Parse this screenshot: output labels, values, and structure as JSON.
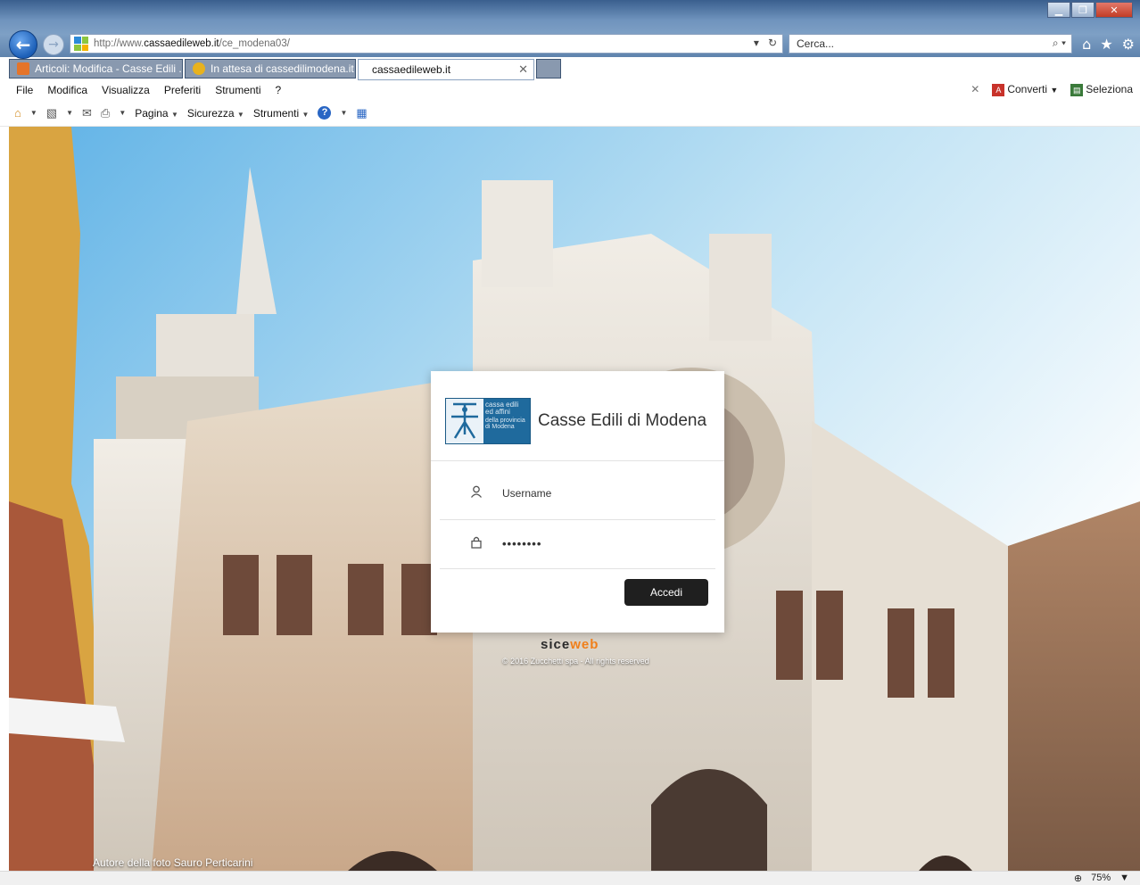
{
  "browser": {
    "address": {
      "prefix": "http://www.",
      "domain": "cassaedileweb.it",
      "path": "/ce_modena03/"
    },
    "search_placeholder": "Cerca...",
    "tabs": [
      {
        "label": "Articoli: Modifica - Casse Edili ...",
        "color": "#e5742a"
      },
      {
        "label": "In attesa di cassedilimodena.it",
        "color": "#e8b21e"
      },
      {
        "label": "cassaedileweb.it",
        "color": "#2c8ad8"
      }
    ],
    "menu": [
      "File",
      "Modifica",
      "Visualizza",
      "Preferiti",
      "Strumenti",
      "?"
    ],
    "menu_right": {
      "converti": "Converti",
      "seleziona": "Seleziona"
    },
    "command": {
      "pagina": "Pagina",
      "sicurezza": "Sicurezza",
      "strumenti": "Strumenti"
    },
    "zoom": "75%"
  },
  "page": {
    "brand_title": "Casse Edili di Modena",
    "logo_text": [
      "cassa edili",
      "ed affini",
      "della provincia",
      "di Modena"
    ],
    "username_placeholder": "Username",
    "password_value": "••••••••",
    "login_button": "Accedi",
    "footer_brand_a": "sice",
    "footer_brand_b": "web",
    "copyright": "© 2016 Zucchetti spa - All rights reserved",
    "photo_credit": "Autore della foto Sauro Perticarini"
  }
}
